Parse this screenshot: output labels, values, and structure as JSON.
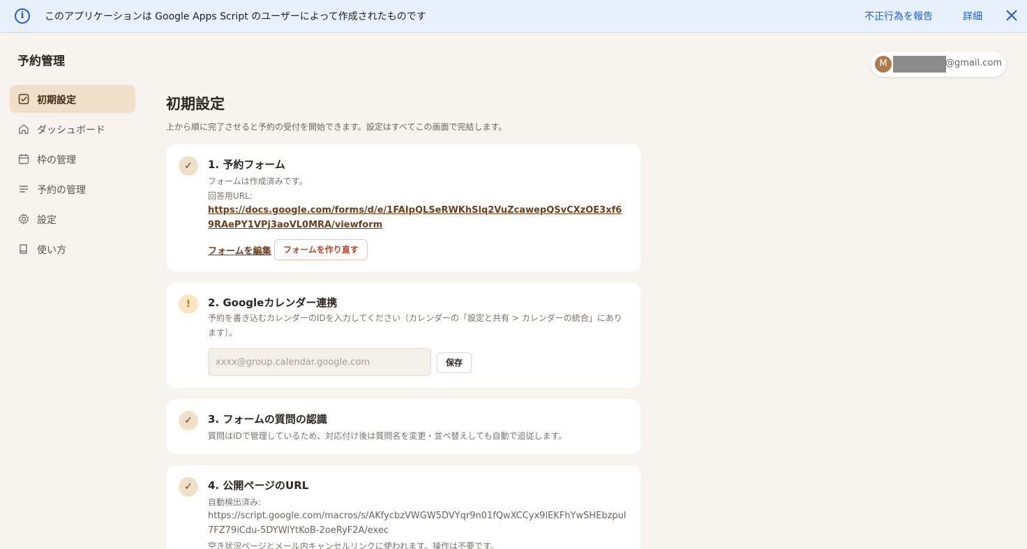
{
  "banner": {
    "info_icon": "info-icon",
    "text": "このアプリケーションは Google Apps Script のユーザーによって作成されたものです",
    "report_link": "不正行為を報告",
    "detail_link": "詳細",
    "close_icon": "close-icon"
  },
  "app": {
    "title": "予約管理"
  },
  "account": {
    "avatar_letter": "M",
    "email_suffix": "@gmail.com"
  },
  "sidebar": {
    "items": [
      {
        "label": "初期設定",
        "icon": "checkbox-icon",
        "active": true
      },
      {
        "label": "ダッシュボード",
        "icon": "home-icon",
        "active": false
      },
      {
        "label": "枠の管理",
        "icon": "calendar-icon",
        "active": false
      },
      {
        "label": "予約の管理",
        "icon": "list-icon",
        "active": false
      },
      {
        "label": "設定",
        "icon": "gear-icon",
        "active": false
      },
      {
        "label": "使い方",
        "icon": "book-icon",
        "active": false
      }
    ]
  },
  "main": {
    "title": "初期設定",
    "subtitle": "上から順に完了させると予約の受付を開始できます。設定はすべてこの画面で完結します。",
    "steps": [
      {
        "status": "done",
        "badge": "✓",
        "title": "1. 予約フォーム",
        "status_text": "フォームは作成済みです。",
        "url_label": "回答用URL:",
        "url": "https://docs.google.com/forms/d/e/1FAIpQLSeRWKhSlq2VuZcawepQSvCXzOE3xf69RAePY1VPj3aoVL0MRA/viewform",
        "edit_link": "フォームを編集",
        "recreate_button": "フォームを作り直す"
      },
      {
        "status": "warning",
        "badge": "!",
        "title": "2. Googleカレンダー連携",
        "description": "予約を書き込むカレンダーのIDを入力してください（カレンダーの「設定と共有 > カレンダーの統合」にあります）。",
        "input_placeholder": "xxxx@group.calendar.google.com",
        "input_value": "",
        "save_button": "保存"
      },
      {
        "status": "done",
        "badge": "✓",
        "title": "3. フォームの質問の認識",
        "description": "質問はIDで管理しているため、対応付け後は質問名を変更・並べ替えしても自動で追従します。"
      },
      {
        "status": "done",
        "badge": "✓",
        "title": "4. 公開ページのURL",
        "detected_label": "自動検出済み:",
        "url": "https://script.google.com/macros/s/AKfycbzVWGW5DVYqr9n01fQwXCCyx9lEKFhYwSHEbzpul7FZ79iCdu-5DYWlYtKoB-2oeRyF2A/exec",
        "note": "空き状況ページとメール内キャンセルリンクに使われます。操作は不要です。"
      }
    ]
  }
}
